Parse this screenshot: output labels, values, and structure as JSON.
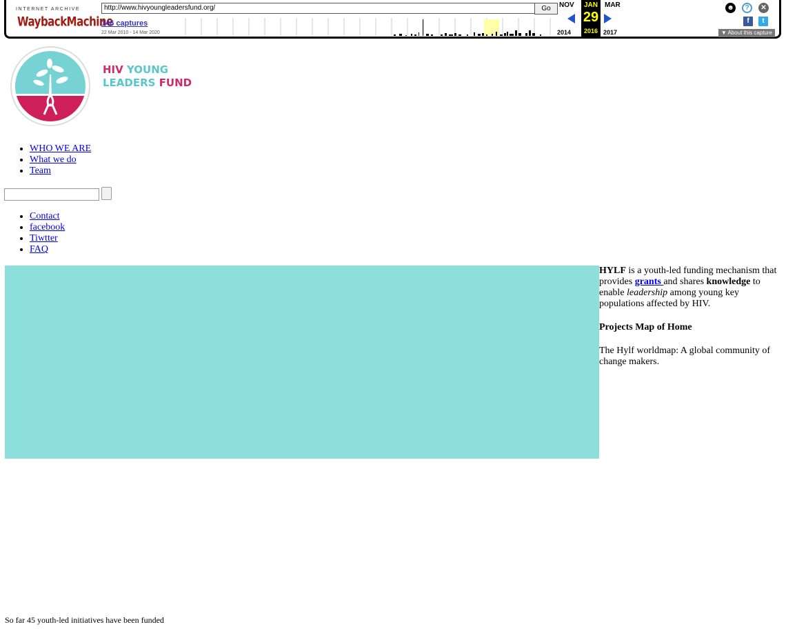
{
  "wayback": {
    "logo_top": "INTERNET ARCHIVE",
    "logo_main": "WaybackMachine",
    "url": "http://www.hivyoungleadersfund.org/",
    "go_label": "Go",
    "captures": "146 captures",
    "range": "22 Mar 2010 - 14 Mar 2020",
    "prev_month": "NOV",
    "cur_month": "JAN",
    "next_month": "MAR",
    "prev_year": "2014",
    "cur_day": "29",
    "cur_year": "2016",
    "next_year": "2017",
    "about": "▼ About this capture",
    "icons": [
      "user-icon",
      "help-icon",
      "close-icon",
      "facebook-icon",
      "twitter-icon"
    ]
  },
  "brand": {
    "line1_a": "HIV ",
    "line1_b": "YOUNG",
    "line2_a": "LEADERS ",
    "line2_b": "FUND",
    "colors": {
      "red": "#cf2a6a",
      "teal": "#58c7cb"
    }
  },
  "nav_primary": [
    "WHO WE ARE",
    "What we do",
    "Team"
  ],
  "nav_secondary": [
    "Contact",
    "facebook",
    "Tiwtter",
    "FAQ"
  ],
  "search": {
    "value": "",
    "button_label": ""
  },
  "map": {
    "color": "#8ddfdc"
  },
  "sidebar": {
    "intro_strong": "HYLF",
    "intro_1": " is a youth-led funding mechanism that provides ",
    "intro_link": "grants ",
    "intro_2": "and shares ",
    "intro_strong2": "knowledge",
    "intro_3": " to enable ",
    "intro_em": "leadership",
    "intro_4": " among young key populations affected by HIV.",
    "projects_heading": "Projects Map of Home",
    "map_text": "The Hylf worldmap:   A global community of change makers."
  },
  "footer": {
    "initiatives": "So far 45 youth-led initiatives have been funded"
  }
}
